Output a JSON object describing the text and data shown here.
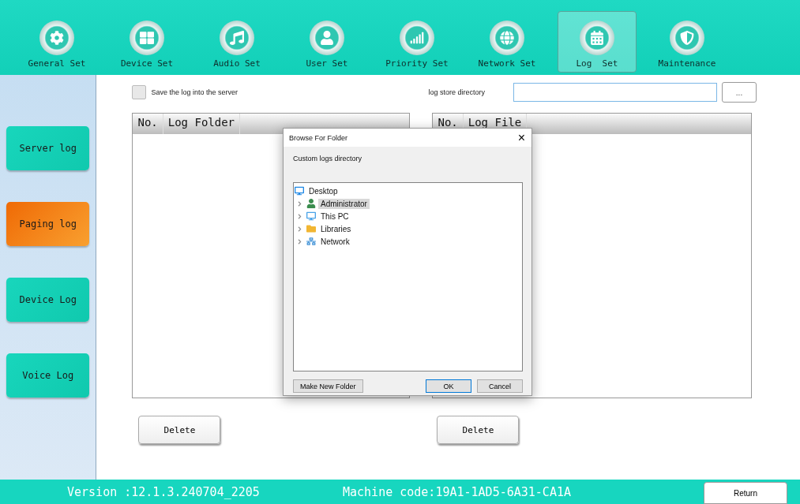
{
  "nav": [
    {
      "label": "General Set",
      "selected": false
    },
    {
      "label": "Device Set",
      "selected": false
    },
    {
      "label": "Audio Set",
      "selected": false
    },
    {
      "label": "User Set",
      "selected": false
    },
    {
      "label": "Priority Set",
      "selected": false
    },
    {
      "label": "Network Set",
      "selected": false
    },
    {
      "label": "Log  Set",
      "selected": true
    },
    {
      "label": "Maintenance",
      "selected": false
    }
  ],
  "sidebar": {
    "items": [
      {
        "label": "Server log",
        "selected": false
      },
      {
        "label": "Paging log",
        "selected": true
      },
      {
        "label": "Device Log",
        "selected": false
      },
      {
        "label": "Voice Log",
        "selected": false
      }
    ]
  },
  "save_option": {
    "label": "Save the log into the server",
    "checked": false
  },
  "directory": {
    "label": "log store directory",
    "browse": "..."
  },
  "folder_table": {
    "columns": [
      "No.",
      "Log Folder"
    ],
    "button": "Delete"
  },
  "file_table": {
    "columns": [
      "No.",
      "Log File"
    ],
    "button": "Delete"
  },
  "dialog": {
    "title": "Browse For Folder",
    "close": "×",
    "prompt": "Custom logs directory",
    "tree": [
      {
        "label": "Desktop",
        "kind": "desktop",
        "selected": false,
        "children": [
          {
            "label": "Administrator",
            "kind": "user",
            "selected": true
          },
          {
            "label": "This PC",
            "kind": "pc",
            "selected": false
          },
          {
            "label": "Libraries",
            "kind": "library",
            "selected": false
          },
          {
            "label": "Network",
            "kind": "network",
            "selected": false
          }
        ]
      }
    ],
    "buttons": {
      "new_folder": "Make New Folder",
      "ok": "OK",
      "cancel": "Cancel"
    }
  },
  "status_bar": {
    "version": "Version :12.1.3.240704_2205",
    "machine": "Machine code:19A1-1AD5-6A31-CA1A",
    "return": "Return"
  }
}
